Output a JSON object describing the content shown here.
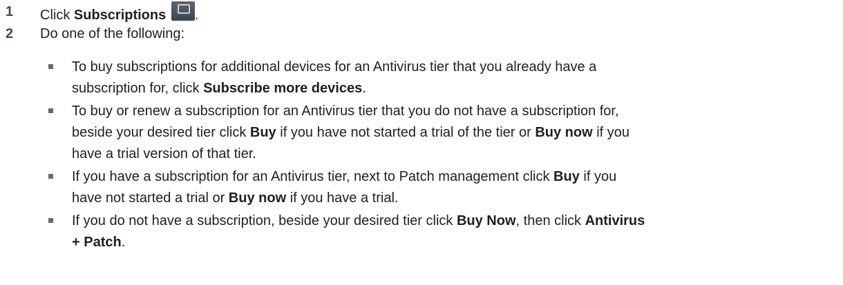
{
  "steps": [
    {
      "number": "1",
      "text_before": "Click ",
      "bold": "Subscriptions",
      "text_after": ".",
      "icon": "subscriptions-icon"
    },
    {
      "number": "2",
      "text": "Do one of the following:"
    }
  ],
  "bullets": [
    {
      "lines": [
        "To buy subscriptions for additional devices for an Antivirus tier that you already have a",
        "subscription for, click "
      ],
      "bold1": "Subscribe more devices",
      "tail1": "."
    },
    {
      "lines": [
        "To buy or renew a subscription for an Antivirus tier that you do not have a subscription for,",
        "beside your desired tier click "
      ],
      "bold1": "Buy",
      "mid1": " if you have not started a trial of the tier or ",
      "bold2": "Buy now",
      "tail2": " if you",
      "line3": "have a trial version of that tier."
    },
    {
      "lines": [
        "If you have a subscription for an Antivirus tier, next to Patch management click "
      ],
      "bold1": "Buy",
      "tail1": " if you",
      "line2_pre": "have not started a trial or ",
      "bold2": "Buy now",
      "line2_post": " if you have a trial."
    },
    {
      "lines": [
        "If you do not have a subscription, beside your desired tier click "
      ],
      "bold1": "Buy Now",
      "mid1": ", then click ",
      "bold2": "Antivirus",
      "line2_bold": "+ Patch",
      "line2_post": "."
    }
  ]
}
